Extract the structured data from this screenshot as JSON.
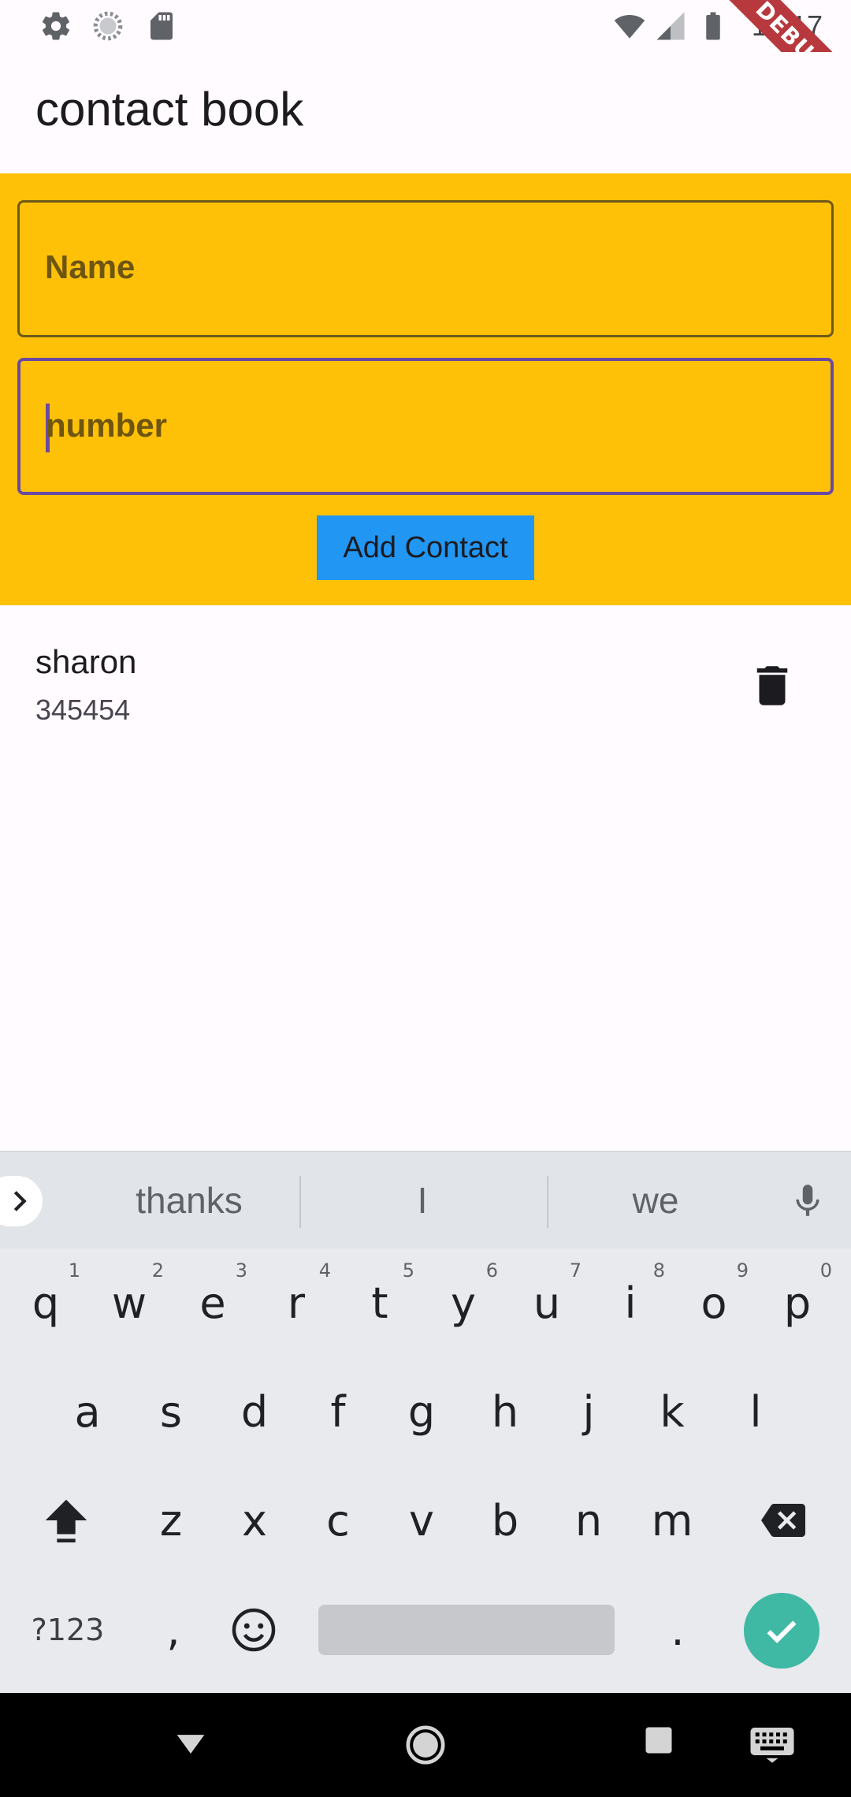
{
  "status_bar": {
    "time": "12:17",
    "debug_label": "DEBUG",
    "icons": [
      "gear-icon",
      "sync-icon",
      "sd-card-icon",
      "wifi-icon",
      "signal-icon",
      "battery-icon"
    ]
  },
  "app_bar": {
    "title": "contact book"
  },
  "form": {
    "name_label": "Name",
    "number_label": "number",
    "add_button_label": "Add Contact",
    "panel_color": "#fec107",
    "button_color": "#2196f3",
    "focus_color": "#6a48a3"
  },
  "contacts": [
    {
      "name": "sharon",
      "number": "345454"
    }
  ],
  "keyboard": {
    "suggestions": [
      "thanks",
      "I",
      "we"
    ],
    "row1": [
      "q",
      "w",
      "e",
      "r",
      "t",
      "y",
      "u",
      "i",
      "o",
      "p"
    ],
    "row1_hints": [
      "1",
      "2",
      "3",
      "4",
      "5",
      "6",
      "7",
      "8",
      "9",
      "0"
    ],
    "row2": [
      "a",
      "s",
      "d",
      "f",
      "g",
      "h",
      "j",
      "k",
      "l"
    ],
    "row3": [
      "z",
      "x",
      "c",
      "v",
      "b",
      "n",
      "m"
    ],
    "symbols_label": "?123",
    "comma_label": ",",
    "period_label": "."
  }
}
